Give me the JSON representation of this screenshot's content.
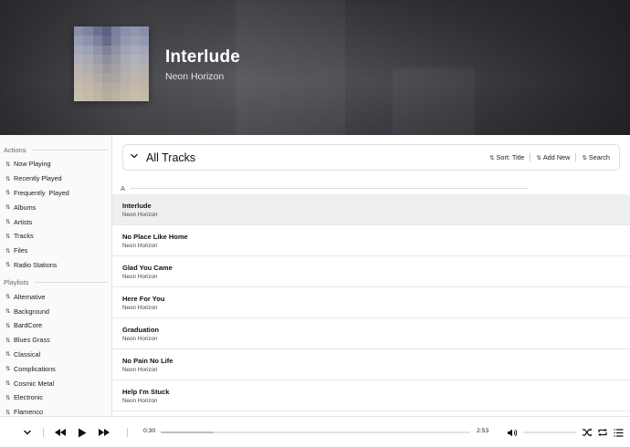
{
  "now_playing": {
    "title": "Interlude",
    "artist": "Neon Horizon"
  },
  "sidebar": {
    "actions_heading": "Actions",
    "actions": [
      {
        "label": "Now Playing",
        "icon": "sort-arrows-icon"
      },
      {
        "label": "Recently Played",
        "icon": "sort-arrows-icon"
      },
      {
        "label": "Frequently  Played",
        "icon": "sort-arrows-icon"
      },
      {
        "label": "Albums",
        "icon": "sort-arrows-icon"
      },
      {
        "label": "Artists",
        "icon": "sort-arrows-icon"
      },
      {
        "label": "Tracks",
        "icon": "sort-arrows-icon"
      },
      {
        "label": "Files",
        "icon": "sort-arrows-icon"
      },
      {
        "label": "Radio Stations",
        "icon": "sort-arrows-icon"
      }
    ],
    "playlists_heading": "Playlists",
    "playlists": [
      {
        "label": "Alternative"
      },
      {
        "label": "Background"
      },
      {
        "label": "BardCore"
      },
      {
        "label": "Blues Grass"
      },
      {
        "label": "Classical"
      },
      {
        "label": "Complications"
      },
      {
        "label": "Cosmic Metal"
      },
      {
        "label": "Electronic"
      },
      {
        "label": "Flamenco"
      }
    ]
  },
  "tracks_panel": {
    "title": "All Tracks",
    "sort_label": "Sort: Title",
    "add_new_label": "Add New",
    "search_label": "Search",
    "section_letter": "A"
  },
  "tracks": [
    {
      "name": "Interlude",
      "artist": "Neon Horizon",
      "active": true
    },
    {
      "name": "No Place Like Home",
      "artist": "Neon Horizon"
    },
    {
      "name": "Glad You Came",
      "artist": "Neon Horizon"
    },
    {
      "name": "Here For You",
      "artist": "Neon Horizon"
    },
    {
      "name": "Graduation",
      "artist": "Neon Horizon"
    },
    {
      "name": "No Pain No Life",
      "artist": "Neon Horizon"
    },
    {
      "name": "Help I'm Stuck",
      "artist": "Neon Horizon"
    }
  ],
  "player": {
    "elapsed": "0:30",
    "duration": "2:53",
    "progress": 0.17,
    "volume": 0.0
  },
  "icons": {
    "collapse": "chevron-down-icon",
    "previous": "previous-icon",
    "play": "play-icon",
    "next": "next-icon",
    "volume": "volume-icon",
    "shuffle": "shuffle-icon",
    "repeat": "repeat-icon",
    "queue": "queue-list-icon"
  },
  "colors": {
    "active_row": "#eef0f0",
    "hero_dark": "#2a2a2e"
  }
}
